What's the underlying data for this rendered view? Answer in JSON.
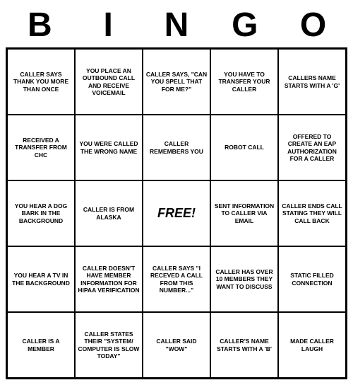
{
  "title": {
    "letters": [
      "B",
      "I",
      "N",
      "G",
      "O"
    ]
  },
  "cells": [
    "CALLER SAYS THANK YOU MORE THAN ONCE",
    "YOU PLACE AN OUTBOUND CALL AND RECEIVE VOICEMAIL",
    "CALLER SAYS, \"CAN YOU SPELL THAT FOR ME?\"",
    "YOU HAVE TO TRANSFER YOUR CALLER",
    "CALLERS NAME STARTS WITH A 'G'",
    "RECEIVED A TRANSFER FROM CHC",
    "YOU WERE CALLED THE WRONG NAME",
    "CALLER REMEMBERS YOU",
    "ROBOT CALL",
    "OFFERED TO CREATE AN EAP AUTHORIZATION FOR A CALLER",
    "YOU HEAR A DOG BARK IN THE BACKGROUND",
    "CALLER IS FROM ALASKA",
    "Free!",
    "SENT INFORMATION TO CALLER VIA EMAIL",
    "CALLER ENDS CALL STATING THEY WILL CALL BACK",
    "YOU HEAR A TV IN THE BACKGROUND",
    "CALLER DOESN'T HAVE MEMBER INFORMATION FOR HIPAA VERIFICATION",
    "CALLER SAYS \"I RECEVED A CALL FROM THIS NUMBER...\"",
    "CALLER HAS OVER 10 MEMBERS THEY WANT TO DISCUSS",
    "STATIC FILLED CONNECTION",
    "CALLER IS A MEMBER",
    "CALLER STATES THEIR \"SYSTEM/ COMPUTER IS SLOW TODAY\"",
    "CALLER SAID \"WOW\"",
    "CALLER'S NAME STARTS WITH A 'B'",
    "MADE CALLER LAUGH"
  ]
}
